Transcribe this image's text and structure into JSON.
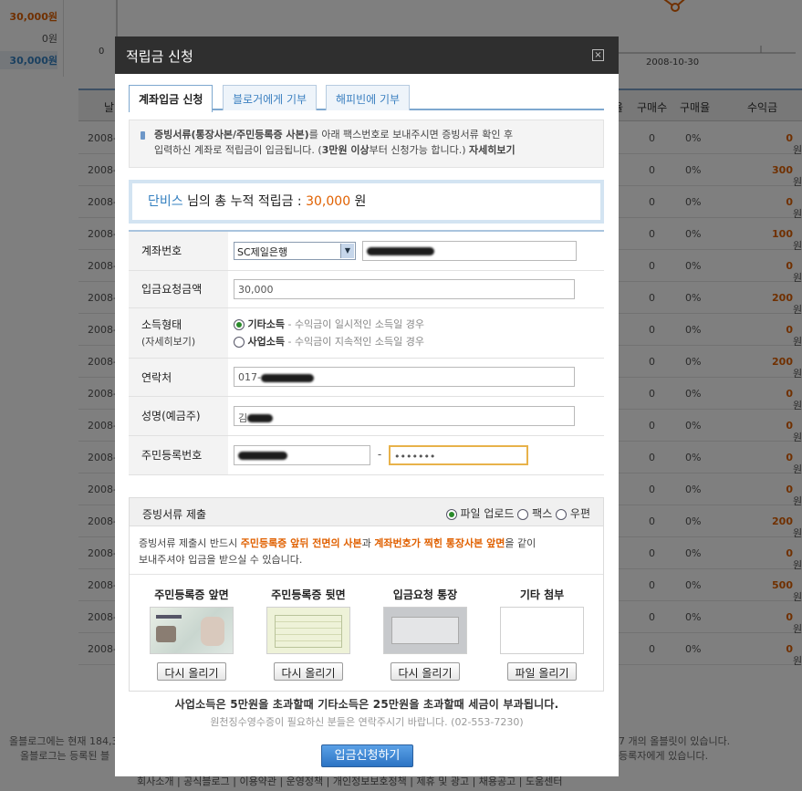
{
  "background": {
    "summary": [
      "30,000원",
      "0원",
      "30,000원"
    ],
    "chart_zero": "0",
    "chart_date": "2008-10-30",
    "headers": [
      "날",
      "율",
      "구매수",
      "구매율",
      "수익금"
    ],
    "rows": [
      {
        "date": "2008-",
        "count": "0",
        "rate": "0%",
        "amount": "0",
        "unit": "원"
      },
      {
        "date": "2008-",
        "count": "0",
        "rate": "0%",
        "amount": "300",
        "unit": "원"
      },
      {
        "date": "2008-",
        "count": "0",
        "rate": "0%",
        "amount": "0",
        "unit": "원"
      },
      {
        "date": "2008-",
        "count": "0",
        "rate": "0%",
        "amount": "100",
        "unit": "원"
      },
      {
        "date": "2008-",
        "count": "0",
        "rate": "0%",
        "amount": "0",
        "unit": "원"
      },
      {
        "date": "2008-",
        "count": "0",
        "rate": "0%",
        "amount": "200",
        "unit": "원"
      },
      {
        "date": "2008-",
        "count": "0",
        "rate": "0%",
        "amount": "0",
        "unit": "원"
      },
      {
        "date": "2008-",
        "count": "0",
        "rate": "0%",
        "amount": "200",
        "unit": "원"
      },
      {
        "date": "2008-",
        "count": "0",
        "rate": "0%",
        "amount": "0",
        "unit": "원"
      },
      {
        "date": "2008-",
        "count": "0",
        "rate": "0%",
        "amount": "0",
        "unit": "원"
      },
      {
        "date": "2008-",
        "count": "0",
        "rate": "0%",
        "amount": "0",
        "unit": "원"
      },
      {
        "date": "2008-",
        "count": "0",
        "rate": "0%",
        "amount": "0",
        "unit": "원"
      },
      {
        "date": "2008-",
        "count": "0",
        "rate": "0%",
        "amount": "200",
        "unit": "원"
      },
      {
        "date": "2008-",
        "count": "0",
        "rate": "0%",
        "amount": "0",
        "unit": "원"
      },
      {
        "date": "2008-",
        "count": "0",
        "rate": "0%",
        "amount": "500",
        "unit": "원"
      },
      {
        "date": "2008-",
        "count": "0",
        "rate": "0%",
        "amount": "0",
        "unit": "원"
      },
      {
        "date": "2008-",
        "count": "0",
        "rate": "0%",
        "amount": "0",
        "unit": "원"
      }
    ],
    "footer1_left": "올블로그에는 현재 184,3",
    "footer1_right": "7 개의 올블릿이 있습니다.",
    "footer2_left": "올블로그는 등록된 블",
    "footer2_right": "등록자에게 있습니다.",
    "nav": "회사소개 | 공식블로그 | 이용약관 | 운영정책 | 개인정보보호정책 | 제휴 및 광고 | 채용공고 | 도움센터"
  },
  "modal": {
    "title": "적립금 신청",
    "close": "×",
    "tabs": [
      "계좌입금 신청",
      "블로거에게 기부",
      "해피빈에 기부"
    ],
    "notice_line1_a": "증빙서류(통장사본/주민등록증 사본)",
    "notice_line1_b": "를 아래 팩스번호로 보내주시면 증빙서류 확인 후",
    "notice_line2_a": "입력하신 계좌로 적립금이 입금됩니다. (",
    "notice_line2_b": "3만원 이상",
    "notice_line2_c": "부터 신청가능 합니다.) ",
    "notice_link": "자세히보기",
    "total_name": "단비스",
    "total_mid": " 님의 총 누적 적립금 : ",
    "total_amount": "30,000",
    "total_unit": " 원",
    "form": {
      "account_label": "계좌번호",
      "bank_value": "SC제일은행",
      "amount_label": "입금요청금액",
      "amount_value": "30,000",
      "income_label": "소득형태",
      "income_sub": "(자세히보기)",
      "income_opt1": "기타소득",
      "income_opt1_desc": " - 수익금이 일시적인 소득일 경우",
      "income_opt2": "사업소득",
      "income_opt2_desc": " - 수익금이 지속적인 소득일 경우",
      "phone_label": "연락처",
      "phone_value": "017-",
      "name_label": "성명(예금주)",
      "name_value": "김",
      "rrn_label": "주민등록번호",
      "rrn_sep": "-",
      "rrn_masked": "•••••••"
    },
    "docs": {
      "title": "증빙서류 제출",
      "opt_upload": "파일 업로드",
      "opt_fax": "팩스",
      "opt_mail": "우편",
      "desc_a": "증빙서류 제출시 반드시 ",
      "desc_b": "주민등록증 앞뒤 전면의 사본",
      "desc_c": "과 ",
      "desc_d": "계좌번호가 찍힌 통장사본 앞면",
      "desc_e": "을 같이",
      "desc_f": "보내주셔야 입금을 받으실 수 있습니다.",
      "cards": [
        {
          "title": "주민등록증 앞면",
          "button": "다시 올리기"
        },
        {
          "title": "주민등록증 뒷면",
          "button": "다시 올리기"
        },
        {
          "title": "입금요청 통장",
          "button": "다시 올리기"
        },
        {
          "title": "기타 첨부",
          "button": "파일 올리기"
        }
      ]
    },
    "tax_note": "사업소득은 5만원을 초과할때 기타소득은 25만원을 초과할때 세금이 부과됩니다.",
    "tax_sub": "원천징수영수증이 필요하신 분들은 연락주시기 바랍니다. (02-553-7230)",
    "submit": "입금신청하기"
  },
  "colors": {
    "accent": "#e06000",
    "link": "#3580c0",
    "title_bar": "#2f2f2f",
    "submit": "#2c74c4"
  }
}
